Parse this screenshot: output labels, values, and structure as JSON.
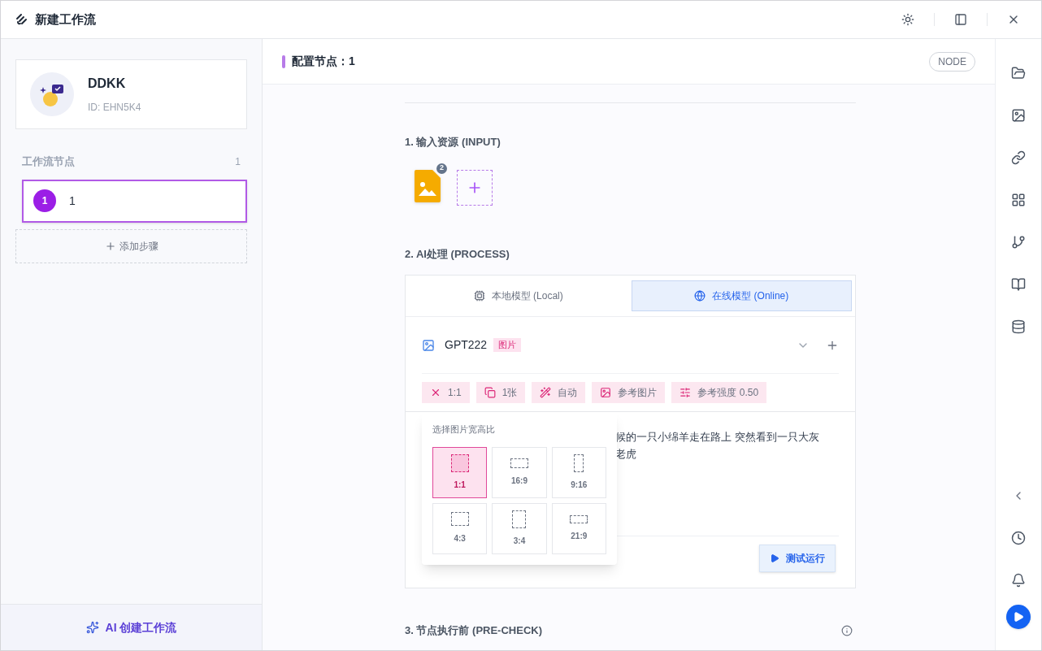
{
  "window": {
    "title": "新建工作流"
  },
  "sidebar": {
    "profile": {
      "name": "DDKK",
      "id": "ID: EHN5K4"
    },
    "nodes_title": "工作流节点",
    "nodes_count": "1",
    "nodes": [
      {
        "badge": "1",
        "label": "1",
        "selected": true
      }
    ],
    "add_step": "添加步骤",
    "ai_create": "AI 创建工作流"
  },
  "header": {
    "title": "配置节点：1",
    "tag": "NODE"
  },
  "input": {
    "title": "1. 输入资源 (INPUT)",
    "file_count": "2"
  },
  "process": {
    "title": "2. AI处理 (PROCESS)",
    "tabs": [
      {
        "label": "本地模型 (Local)",
        "selected": false,
        "kind": "local"
      },
      {
        "label": "在线模型 (Online)",
        "selected": true,
        "kind": "online"
      }
    ],
    "model": {
      "name": "GPT222",
      "tag": "图片"
    },
    "chips": [
      {
        "kind": "ratio",
        "label": "1:1"
      },
      {
        "kind": "count",
        "label": "1张"
      },
      {
        "kind": "auto",
        "label": "自动"
      },
      {
        "kind": "ref",
        "label": "参考图片"
      },
      {
        "kind": "strength",
        "label": "参考强度 0.50"
      }
    ],
    "prompt_lines": [
      "候的一只小绵羊走在路上 突然看到一只大灰",
      "老虎"
    ],
    "run": "测试运行",
    "ratio_popover": {
      "title": "选择图片宽高比",
      "options": [
        {
          "label": "1:1",
          "selected": true
        },
        {
          "label": "16:9",
          "selected": false
        },
        {
          "label": "9:16",
          "selected": false
        },
        {
          "label": "4:3",
          "selected": false
        },
        {
          "label": "3:4",
          "selected": false
        },
        {
          "label": "21:9",
          "selected": false
        }
      ]
    }
  },
  "precheck": {
    "title": "3. 节点执行前 (PRE-CHECK)"
  }
}
